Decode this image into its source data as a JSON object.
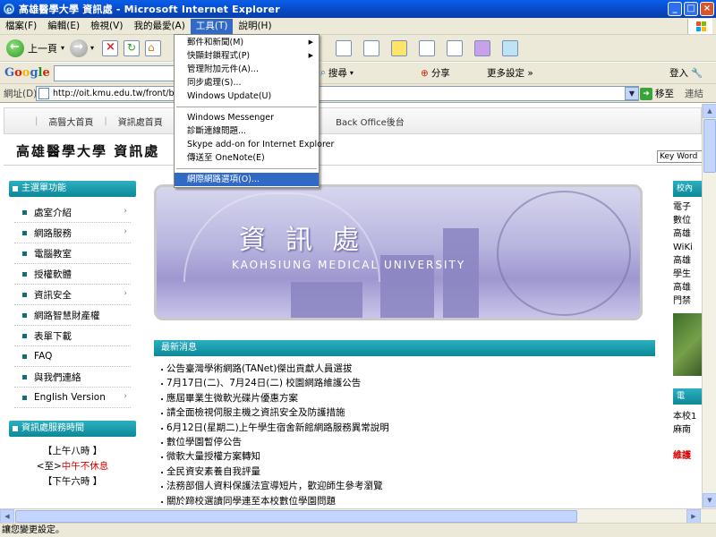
{
  "window": {
    "title": "高雄醫學大學 資訊處 - Microsoft Internet Explorer"
  },
  "menubar": [
    "檔案(F)",
    "編輯(E)",
    "檢視(V)",
    "我的最愛(A)",
    "工具(T)",
    "說明(H)"
  ],
  "toolbar": {
    "back_label": "上一頁"
  },
  "googlebar": {
    "logo": "Google",
    "search_label": "搜尋",
    "share_label": "分享",
    "more_label": "更多設定 »",
    "login_label": "登入"
  },
  "address": {
    "label": "網址(D)",
    "url": "http://oit.kmu.edu.tw/front/bin/home.php",
    "go_label": "移至",
    "links_label": "連結"
  },
  "tools_menu": {
    "items": [
      {
        "label": "郵件和新聞(M)",
        "submenu": true
      },
      {
        "label": "快顯封鎖程式(P)",
        "submenu": true
      },
      {
        "label": "管理附加元件(A)...",
        "submenu": false
      },
      {
        "label": "同步處理(S)...",
        "submenu": false
      },
      {
        "label": "Windows Update(U)",
        "submenu": false
      },
      {
        "label": "Windows Messenger",
        "submenu": false,
        "sep_before": true
      },
      {
        "label": "診斷連線問題...",
        "submenu": false
      },
      {
        "label": "Skype add-on for Internet Explorer",
        "submenu": false
      },
      {
        "label": "傳送至 OneNote(E)",
        "submenu": false
      },
      {
        "label": "網際網路選項(O)...",
        "submenu": false,
        "sep_before": true,
        "selected": true
      }
    ]
  },
  "site": {
    "topnav": [
      "高醫大首頁",
      "資訊處首頁",
      "Back Office後台"
    ],
    "title": "高雄醫學大學 資訊處",
    "keyword": "Key Word",
    "left_panel_title": "主選單功能",
    "left_menu": [
      {
        "label": "處室介紹",
        "arrow": true
      },
      {
        "label": "網路服務",
        "arrow": true
      },
      {
        "label": "電腦教室",
        "arrow": false
      },
      {
        "label": "授權軟體",
        "arrow": false
      },
      {
        "label": "資訊安全",
        "arrow": true
      },
      {
        "label": "網路智慧財產權",
        "arrow": false
      },
      {
        "label": "表單下載",
        "arrow": false
      },
      {
        "label": "FAQ",
        "arrow": false
      },
      {
        "label": "與我們連絡",
        "arrow": false
      },
      {
        "label": "English Version",
        "arrow": true
      }
    ],
    "hours_title": "資訊處服務時間",
    "hours": {
      "line1": "【上午八時 】",
      "line2_prefix": "<至>",
      "line2_red": "中午不休息",
      "line3": "【下午六時 】"
    },
    "banner": {
      "title": "資訊處",
      "subtitle": "KAOHSIUNG MEDICAL UNIVERSITY"
    },
    "news_title": "最新消息",
    "news": [
      "公告臺灣學術網路(TANet)傑出貢獻人員選拔",
      "7月17日(二)、7月24日(二) 校園網路維護公告",
      "應屆畢業生微軟光碟片優惠方案",
      "請全面檢視伺服主機之資訊安全及防護措施",
      "6月12日(星期二)上午學生宿舍新館網路服務異常說明",
      "數位學園暫停公告",
      "微軟大量授權方案轉知",
      "全民資安素養自我評量",
      "法務部個人資料保護法宣導短片，歡迎師生參考瀏覽",
      "關於蹄校選讀同學連至本校數位學園問題"
    ],
    "right_head": "校內",
    "right_items": [
      "電子",
      "數位",
      "高雄",
      "WiKi",
      "高雄",
      "學生",
      "高雄",
      "門禁"
    ],
    "right_head2": "電",
    "right_text": [
      "本校1",
      "麻南"
    ],
    "right_red": "維護"
  },
  "status": {
    "text": "讓您變更設定。"
  }
}
